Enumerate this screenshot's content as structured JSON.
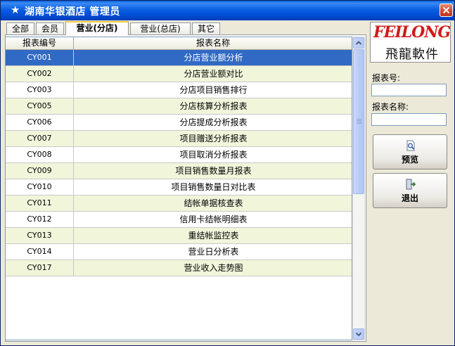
{
  "window": {
    "title_star": "★",
    "title": "湖南华银酒店 管理员"
  },
  "tabs": [
    {
      "label": "全部"
    },
    {
      "label": "会员"
    },
    {
      "label": "营业(分店)",
      "active": true
    },
    {
      "label": "营业(总店)"
    },
    {
      "label": "其它"
    }
  ],
  "grid": {
    "columns": [
      "报表编号",
      "报表名称"
    ],
    "rows": [
      {
        "code": "CY001",
        "name": "分店营业额分析",
        "selected": true
      },
      {
        "code": "CY002",
        "name": "分店营业额对比"
      },
      {
        "code": "CY003",
        "name": "分店项目销售排行"
      },
      {
        "code": "CY005",
        "name": "分店核算分析报表"
      },
      {
        "code": "CY006",
        "name": "分店提成分析报表"
      },
      {
        "code": "CY007",
        "name": "项目赠送分析报表"
      },
      {
        "code": "CY008",
        "name": "项目取消分析报表"
      },
      {
        "code": "CY009",
        "name": "项目销售数量月报表"
      },
      {
        "code": "CY010",
        "name": "项目销售数量日对比表"
      },
      {
        "code": "CY011",
        "name": "结帐单据核查表"
      },
      {
        "code": "CY012",
        "name": "信用卡结帐明细表"
      },
      {
        "code": "CY013",
        "name": "重结帐监控表"
      },
      {
        "code": "CY014",
        "name": "营业日分析表"
      },
      {
        "code": "CY017",
        "name": "营业收入走势图"
      }
    ]
  },
  "logo": {
    "latin": "FEILONG",
    "chinese": "飛龍軟件"
  },
  "side": {
    "report_no_label": "报表号:",
    "report_no_value": "",
    "report_name_label": "报表名称:",
    "report_name_value": ""
  },
  "buttons": {
    "preview_label": "预览",
    "exit_label": "退出"
  },
  "colors": {
    "selected_row": "#316ac5",
    "alt_row": "#f1f6db",
    "titlebar": "#0a5fd8",
    "logo_red": "#cf1c1c"
  }
}
